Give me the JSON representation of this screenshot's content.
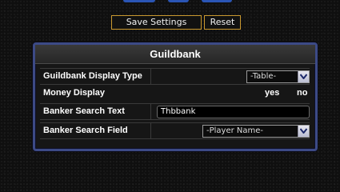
{
  "toolbar": {
    "save_label": "Save Settings",
    "reset_label": "Reset"
  },
  "panel": {
    "title": "Guildbank",
    "display_type": {
      "label": "Guildbank Display Type",
      "selected": "-Table-"
    },
    "money_display": {
      "label": "Money Display",
      "yes_label": "yes",
      "no_label": "no"
    },
    "banker_search_text": {
      "label": "Banker Search Text",
      "value": "Thbbank"
    },
    "banker_search_field": {
      "label": "Banker Search Field",
      "selected": "-Player Name-"
    }
  },
  "icons": {
    "dropdown_arrow": "chevron-down-icon"
  },
  "colors": {
    "button_border": "#c9982f",
    "panel_border": "#3c4a86",
    "header_bg": "#2f2f2f",
    "background": "#0f0f0f"
  }
}
